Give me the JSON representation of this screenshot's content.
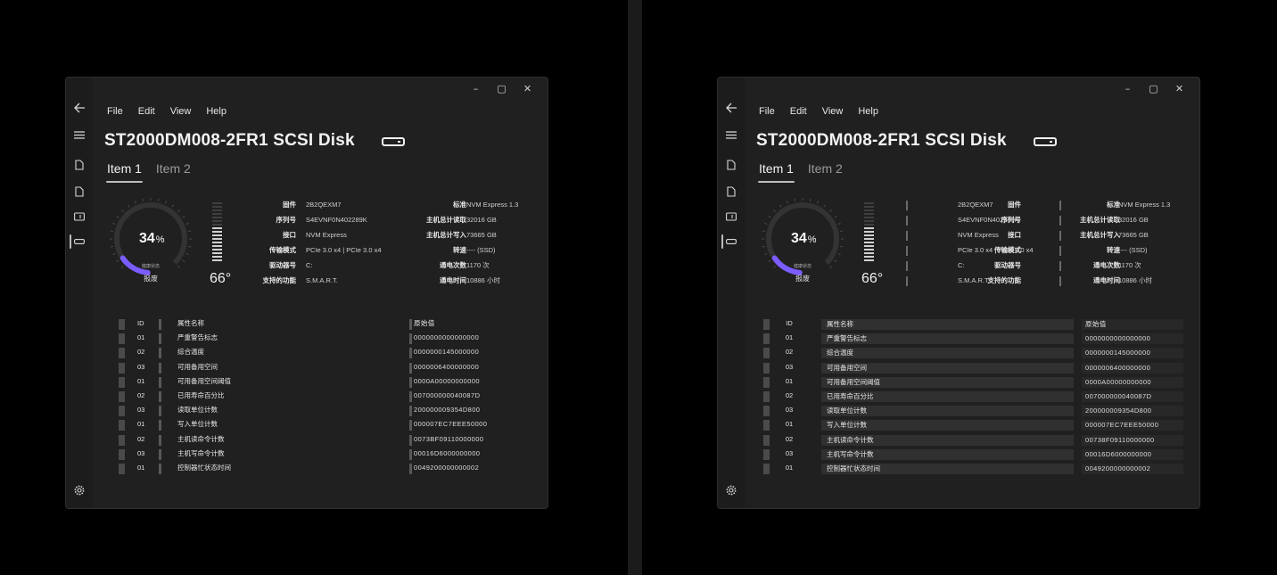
{
  "windows": [
    {
      "id": "left",
      "caption": {
        "minimize": "–",
        "maximize": "▢",
        "close": "✕"
      },
      "menu": [
        "File",
        "Edit",
        "View",
        "Help"
      ],
      "title": "ST2000DM008-2FR1 SCSI Disk",
      "tabs": [
        "Item 1",
        "Item 2"
      ],
      "health": {
        "percent": "34",
        "unit": "%",
        "label": "健康状态",
        "status": "报废",
        "value": 0.34,
        "accent": "#7b5cff"
      },
      "temperature": "66°",
      "info_left": [
        {
          "key": "固件",
          "value": "2B2QEXM7"
        },
        {
          "key": "序列号",
          "value": "S4EVNF0N402289K"
        },
        {
          "key": "接口",
          "value": "NVM Express"
        },
        {
          "key": "传输模式",
          "value": "PCIe 3.0 x4 | PCIe 3.0 x4"
        },
        {
          "key": "驱动器号",
          "value": "C:"
        },
        {
          "key": "支持的功能",
          "value": "S.M.A.R.T."
        }
      ],
      "info_right": [
        {
          "key": "标准",
          "value": "NVM Express 1.3"
        },
        {
          "key": "主机总计读取",
          "value": "32016 GB"
        },
        {
          "key": "主机总计写入",
          "value": "73665 GB"
        },
        {
          "key": "转速",
          "value": "---- (SSD)"
        },
        {
          "key": "通电次数",
          "value": "1170 次"
        },
        {
          "key": "通电时间",
          "value": "10886 小时"
        }
      ],
      "table": {
        "headers": {
          "id": "ID",
          "name": "属性名称",
          "raw": "原始值"
        },
        "rows": [
          {
            "id": "01",
            "name": "严重警告标志",
            "raw": "0000000000000000"
          },
          {
            "id": "02",
            "name": "综合温度",
            "raw": "0000000145000000"
          },
          {
            "id": "03",
            "name": "可用备用空间",
            "raw": "0000006400000000"
          },
          {
            "id": "01",
            "name": "可用备用空间阈值",
            "raw": "0000A00000000000"
          },
          {
            "id": "02",
            "name": "已用寿命百分比",
            "raw": "007000000040087D"
          },
          {
            "id": "03",
            "name": "读取单位计数",
            "raw": "200000009354D800"
          },
          {
            "id": "01",
            "name": "写入单位计数",
            "raw": "000007EC7EEE50000"
          },
          {
            "id": "02",
            "name": "主机读命令计数",
            "raw": "0073BF09110000000"
          },
          {
            "id": "03",
            "name": "主机写命令计数",
            "raw": "00016D6000000000"
          },
          {
            "id": "01",
            "name": "控制器忙状态时间",
            "raw": "0049200000000002"
          }
        ]
      }
    },
    {
      "id": "right",
      "caption": {
        "minimize": "–",
        "maximize": "▢",
        "close": "✕"
      },
      "menu": [
        "File",
        "Edit",
        "View",
        "Help"
      ],
      "title": "ST2000DM008-2FR1 SCSI Disk",
      "tabs": [
        "Item 1",
        "Item 2"
      ],
      "health": {
        "percent": "34",
        "unit": "%",
        "label": "健康状态",
        "status": "报废",
        "value": 0.34,
        "accent": "#7b5cff"
      },
      "temperature": "66°",
      "info_left": [
        {
          "key": "固件",
          "value": "2B2QEXM7"
        },
        {
          "key": "序列号",
          "value": "S4EVNF0N402289K"
        },
        {
          "key": "接口",
          "value": "NVM Express"
        },
        {
          "key": "传输模式",
          "value": "PCIe 3.0 x4 | PCIe 3.0 x4"
        },
        {
          "key": "驱动器号",
          "value": "C:"
        },
        {
          "key": "支持的功能",
          "value": "S.M.A.R.T."
        }
      ],
      "info_right": [
        {
          "key": "标准",
          "value": "NVM Express 1.3"
        },
        {
          "key": "主机总计读取",
          "value": "32016 GB"
        },
        {
          "key": "主机总计写入",
          "value": "73665 GB"
        },
        {
          "key": "转速",
          "value": "---- (SSD)"
        },
        {
          "key": "通电次数",
          "value": "1170 次"
        },
        {
          "key": "通电时间",
          "value": "10886 小时"
        }
      ],
      "table": {
        "headers": {
          "id": "ID",
          "name": "属性名称",
          "raw": "原始值"
        },
        "rows": [
          {
            "id": "01",
            "name": "严重警告标志",
            "raw": "0000000000000000"
          },
          {
            "id": "02",
            "name": "综合温度",
            "raw": "0000000145000000"
          },
          {
            "id": "03",
            "name": "可用备用空间",
            "raw": "0000006400000000"
          },
          {
            "id": "01",
            "name": "可用备用空间阈值",
            "raw": "0000A00000000000"
          },
          {
            "id": "02",
            "name": "已用寿命百分比",
            "raw": "007000000040087D"
          },
          {
            "id": "03",
            "name": "读取单位计数",
            "raw": "200000009354D800"
          },
          {
            "id": "01",
            "name": "写入单位计数",
            "raw": "000007EC7EEE50000"
          },
          {
            "id": "02",
            "name": "主机读命令计数",
            "raw": "00738F09110000000"
          },
          {
            "id": "03",
            "name": "主机写命令计数",
            "raw": "00016D6000000000"
          },
          {
            "id": "01",
            "name": "控制器忙状态时间",
            "raw": "0049200000000002"
          }
        ]
      }
    }
  ],
  "icons": [
    "back-arrow-icon",
    "hamburger-menu-icon",
    "document-icon",
    "document-icon",
    "drive-card-icon",
    "disk-icon",
    "gear-icon"
  ]
}
